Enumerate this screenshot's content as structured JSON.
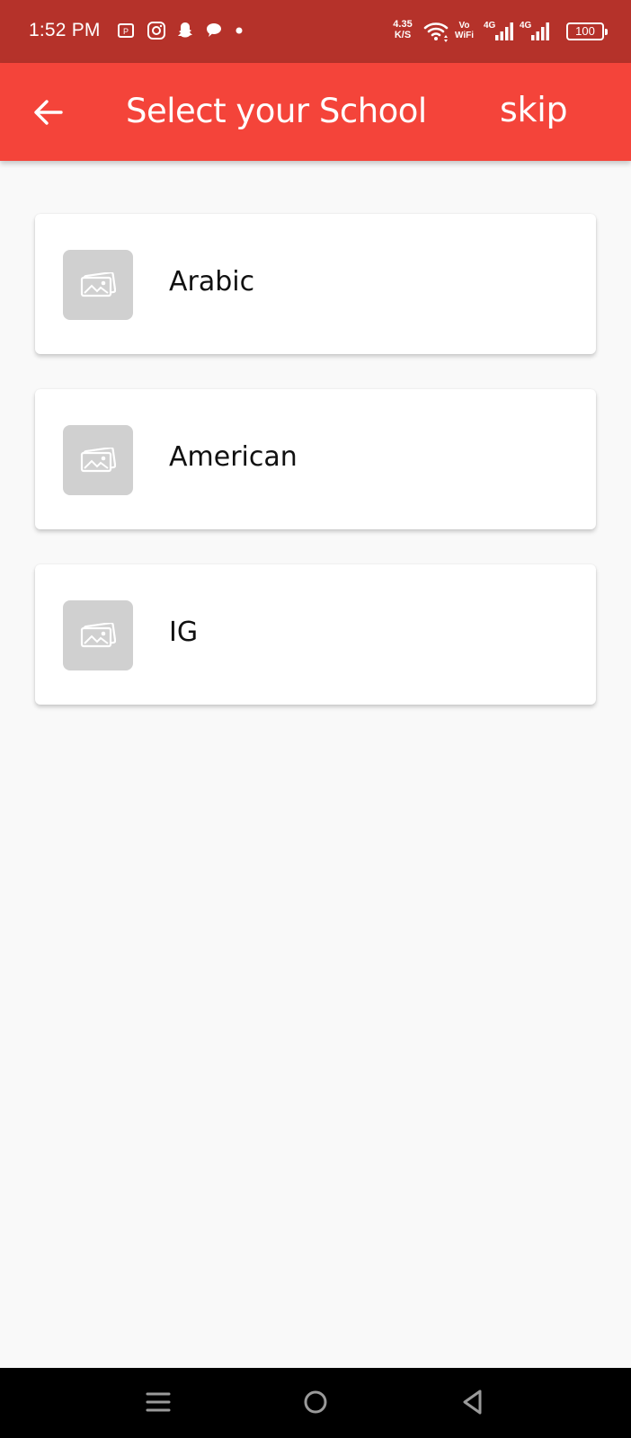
{
  "status_bar": {
    "time": "1:52 PM",
    "net_speed_value": "4.35",
    "net_speed_unit": "K/S",
    "vowifi_top": "Vo",
    "vowifi_bottom": "WiFi",
    "sim1_label": "4G",
    "sim2_label": "4G",
    "battery": "100",
    "icons": [
      "pocket-app-icon",
      "instagram-icon",
      "snapchat-icon",
      "chat-bubble-icon",
      "notification-dot-icon",
      "wifi-icon",
      "signal-icon",
      "battery-icon"
    ]
  },
  "app_bar": {
    "title": "Select your School",
    "skip_label": "skip",
    "back_icon": "arrow-left-icon",
    "background": "#f4443a"
  },
  "schools": [
    {
      "name": "Arabic",
      "thumbnail_icon": "image-placeholder-icon"
    },
    {
      "name": "American",
      "thumbnail_icon": "image-placeholder-icon"
    },
    {
      "name": "IG",
      "thumbnail_icon": "image-placeholder-icon"
    }
  ],
  "nav_bar": {
    "icons": [
      "recents-icon",
      "home-icon",
      "back-triangle-icon"
    ]
  },
  "colors": {
    "status_bar": "#b5322a",
    "app_bar": "#f4443a",
    "page_background": "#f9f9f9",
    "placeholder": "#d0d0d0"
  }
}
